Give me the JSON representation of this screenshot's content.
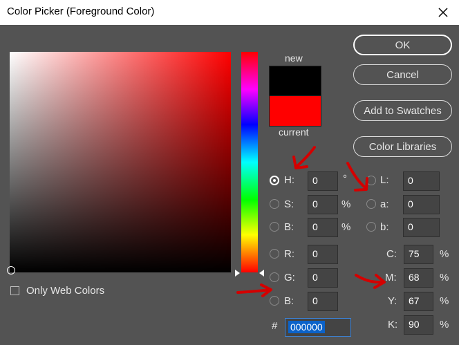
{
  "window": {
    "title": "Color Picker (Foreground Color)"
  },
  "buttons": {
    "ok": "OK",
    "cancel": "Cancel",
    "add_to_swatches": "Add to Swatches",
    "color_libraries": "Color Libraries"
  },
  "swatch": {
    "new_label": "new",
    "current_label": "current",
    "new_color": "#000000",
    "current_color": "#ff0000"
  },
  "hsb": {
    "h": {
      "label": "H:",
      "value": "0",
      "unit": "°"
    },
    "s": {
      "label": "S:",
      "value": "0",
      "unit": "%"
    },
    "b": {
      "label": "B:",
      "value": "0",
      "unit": "%"
    }
  },
  "rgb": {
    "r": {
      "label": "R:",
      "value": "0"
    },
    "g": {
      "label": "G:",
      "value": "0"
    },
    "b": {
      "label": "B:",
      "value": "0"
    }
  },
  "lab": {
    "l": {
      "label": "L:",
      "value": "0"
    },
    "a": {
      "label": "a:",
      "value": "0"
    },
    "b": {
      "label": "b:",
      "value": "0"
    }
  },
  "cmyk": {
    "c": {
      "label": "C:",
      "value": "75",
      "unit": "%"
    },
    "m": {
      "label": "M:",
      "value": "68",
      "unit": "%"
    },
    "y": {
      "label": "Y:",
      "value": "67",
      "unit": "%"
    },
    "k": {
      "label": "K:",
      "value": "90",
      "unit": "%"
    }
  },
  "hex": {
    "label": "#",
    "value": "000000"
  },
  "web_colors": {
    "label": "Only Web Colors"
  },
  "colors": {
    "annotation": "#d40000",
    "field_hue": "#ff0000"
  }
}
